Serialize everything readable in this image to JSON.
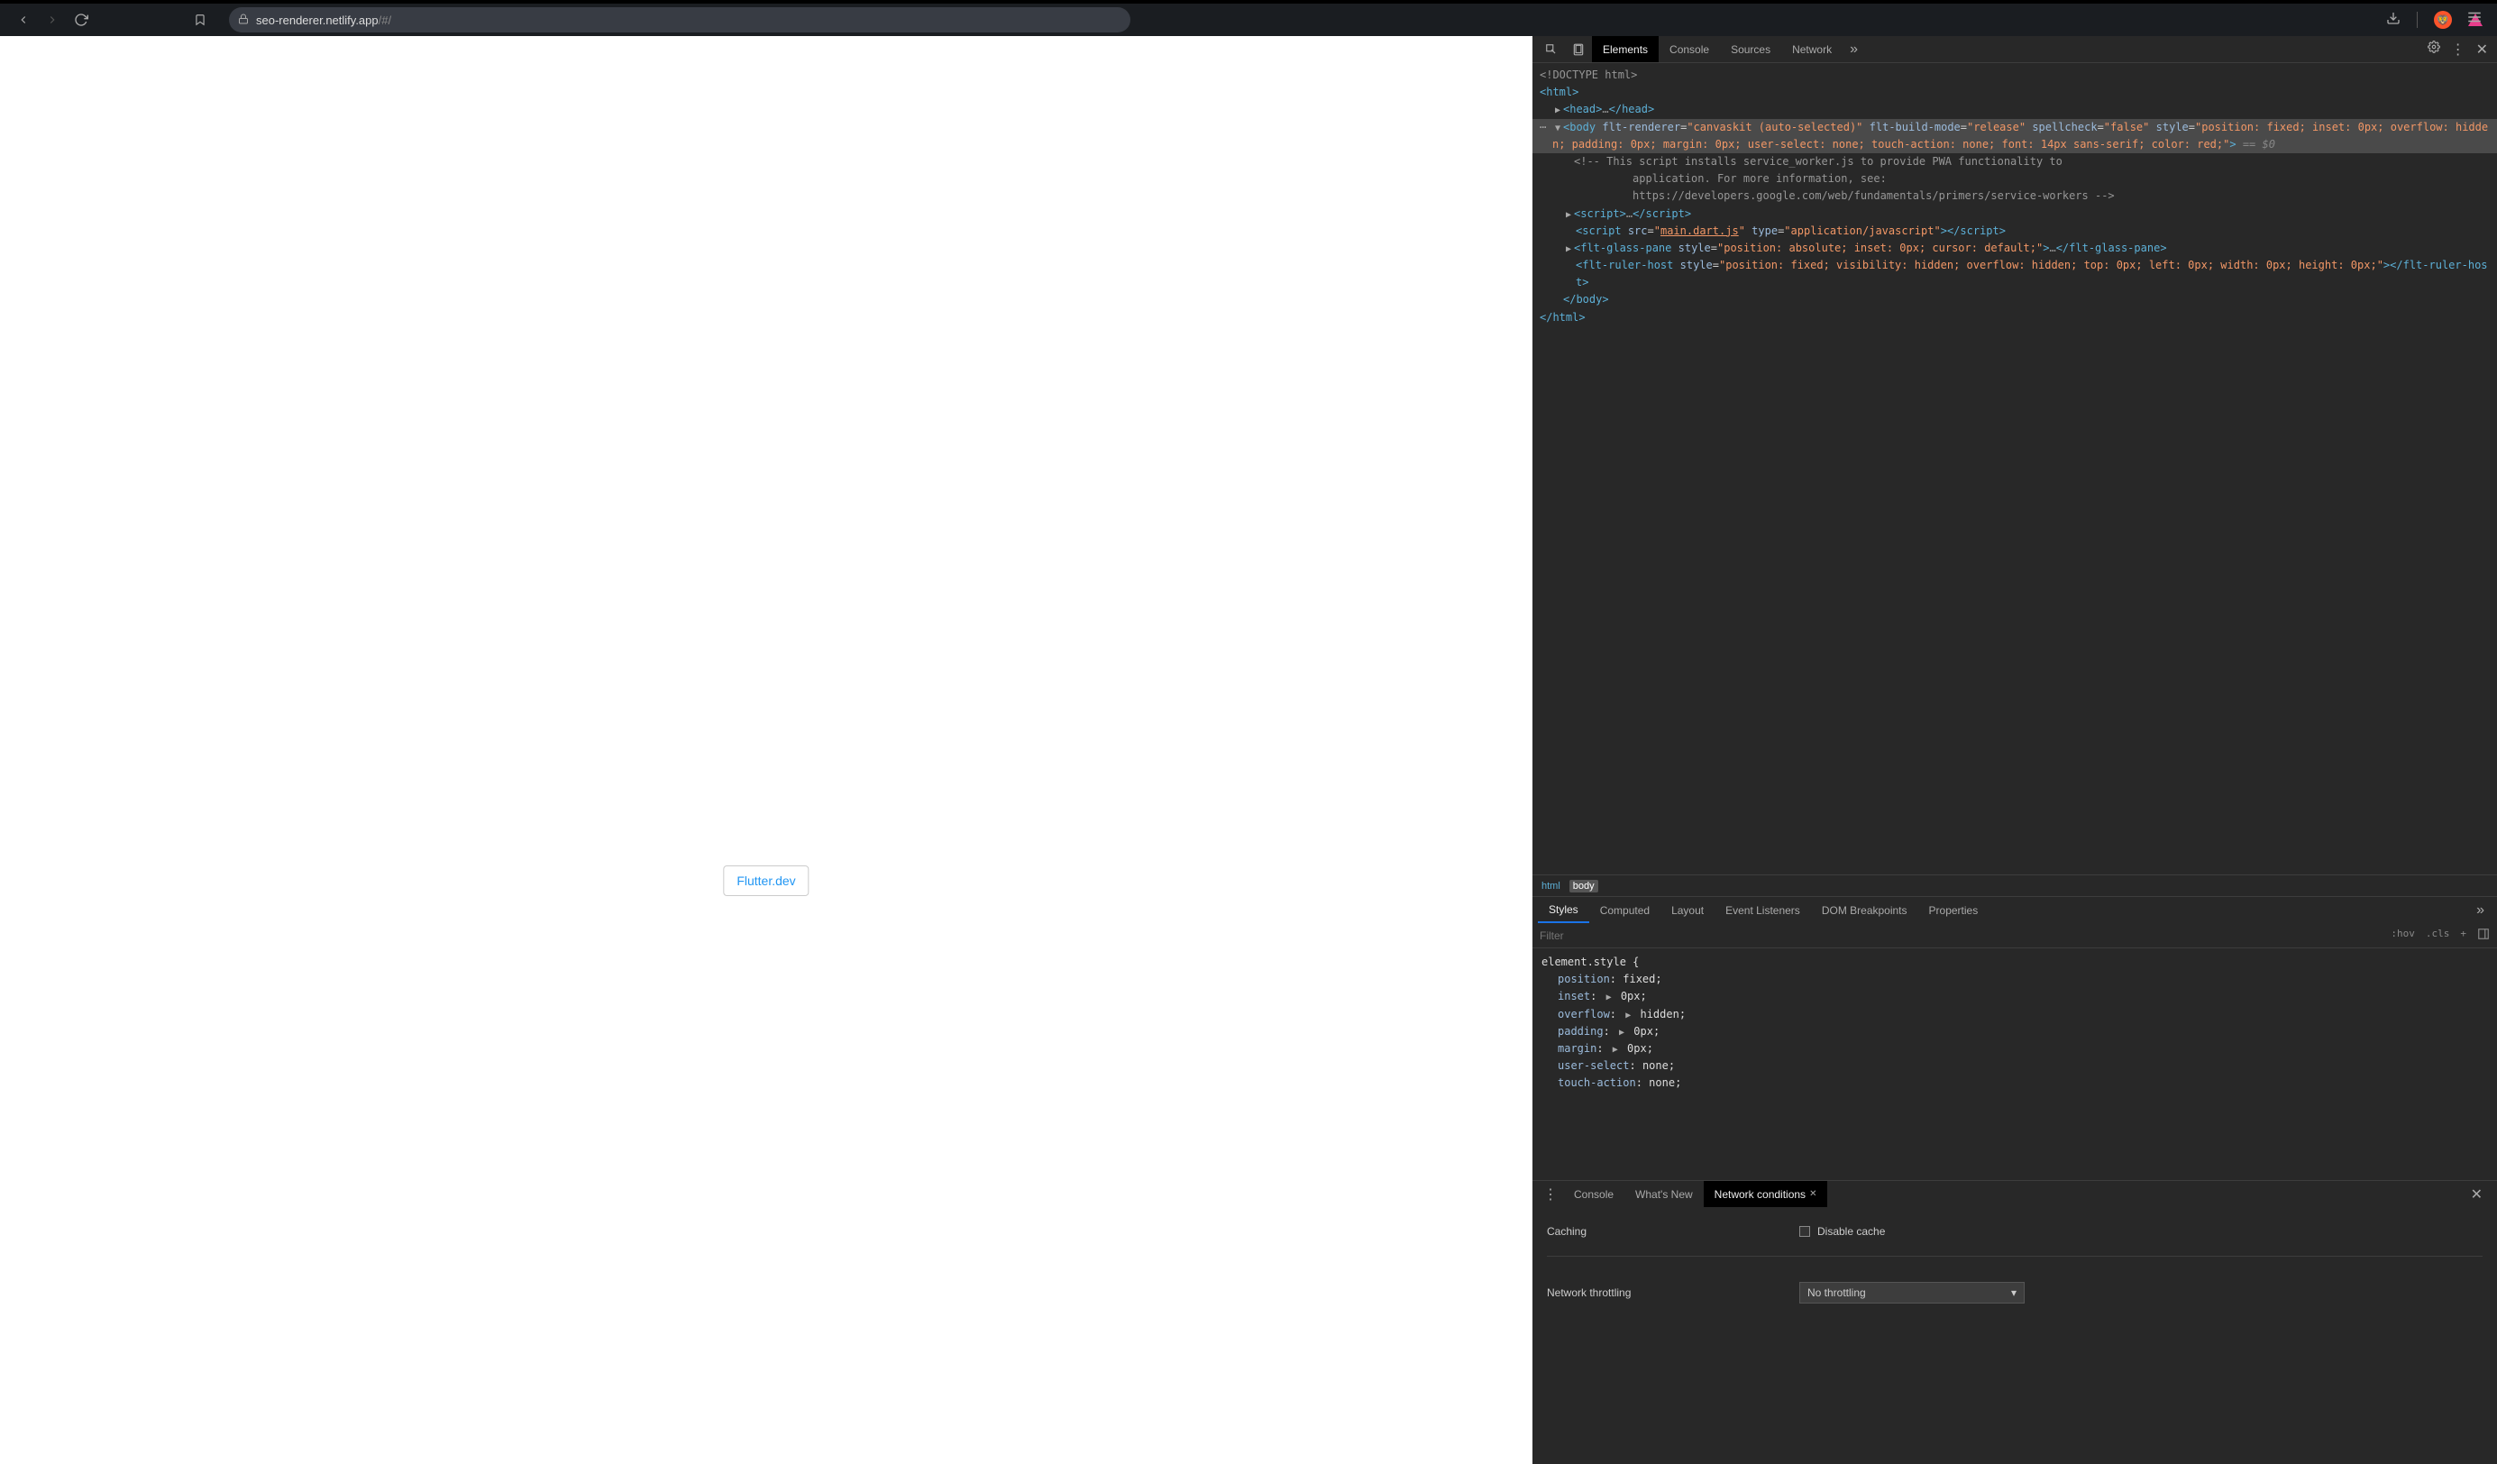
{
  "browser": {
    "url_main": "seo-renderer.netlify.app",
    "url_sub": "/#/"
  },
  "page": {
    "link_text": "Flutter.dev"
  },
  "devtools": {
    "tabs": [
      "Elements",
      "Console",
      "Sources",
      "Network"
    ],
    "active_tab": "Elements",
    "dom": {
      "doctype": "<!DOCTYPE html>",
      "html_open": "html",
      "head_open": "head",
      "head_ellipsis": "…",
      "head_close": "head",
      "body_tag": "body",
      "body_attr1_name": "flt-renderer",
      "body_attr1_val": "canvaskit (auto-selected)",
      "body_attr2_name": "flt-build-mode",
      "body_attr2_val": "release",
      "body_attr3_name": "spellcheck",
      "body_attr3_val": "false",
      "body_attr4_name": "style",
      "body_attr4_val": "position: fixed; inset: 0px; overflow: hidden; padding: 0px; margin: 0px; user-select: none; touch-action: none; font: 14px sans-serif; color: red;",
      "eq0": " == $0",
      "comment": "<!-- This script installs service_worker.js to provide PWA functionality to\n         application. For more information, see:\n         https://developers.google.com/web/fundamentals/primers/service-workers -->",
      "script1": "script",
      "script2_tag": "script",
      "script2_src_attr": "src",
      "script2_src_val": "main.dart.js",
      "script2_type_attr": "type",
      "script2_type_val": "application/javascript",
      "glass_tag": "flt-glass-pane",
      "glass_style_attr": "style",
      "glass_style_val": "position: absolute; inset: 0px; cursor: default;",
      "glass_close": "flt-glass-pane",
      "ruler_tag": "flt-ruler-host",
      "ruler_style_attr": "style",
      "ruler_style_val": "position: fixed; visibility: hidden; overflow: hidden; top: 0px; left: 0px; width: 0px; height: 0px;",
      "ruler_close": "flt-ruler-host",
      "body_close": "body",
      "html_close": "html"
    },
    "breadcrumb": [
      "html",
      "body"
    ],
    "styles_tabs": [
      "Styles",
      "Computed",
      "Layout",
      "Event Listeners",
      "DOM Breakpoints",
      "Properties"
    ],
    "styles_active": "Styles",
    "filter_placeholder": "Filter",
    "filter_btns": [
      ":hov",
      ".cls",
      "+"
    ],
    "styles": {
      "selector": "element.style {",
      "props": [
        {
          "name": "position",
          "val": "fixed"
        },
        {
          "name": "inset",
          "val": "0px",
          "arrow": true
        },
        {
          "name": "overflow",
          "val": "hidden",
          "arrow": true
        },
        {
          "name": "padding",
          "val": "0px",
          "arrow": true
        },
        {
          "name": "margin",
          "val": "0px",
          "arrow": true
        },
        {
          "name": "user-select",
          "val": "none"
        },
        {
          "name": "touch-action",
          "val": "none"
        }
      ]
    },
    "drawer": {
      "tabs": [
        "Console",
        "What's New",
        "Network conditions"
      ],
      "active": "Network conditions",
      "caching_label": "Caching",
      "disable_cache": "Disable cache",
      "throttling_label": "Network throttling",
      "throttling_value": "No throttling"
    }
  }
}
